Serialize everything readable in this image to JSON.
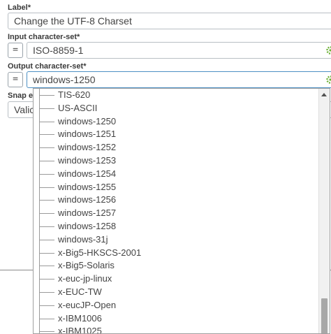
{
  "form": {
    "label": {
      "title": "Label*",
      "value": "Change the UTF-8 Charset"
    },
    "input_charset": {
      "title": "Input character-set*",
      "value": "ISO-8859-1",
      "eq_label": "="
    },
    "output_charset": {
      "title": "Output character-set*",
      "value": "windows-1250",
      "eq_label": "="
    },
    "snap": {
      "title": "Snap e",
      "value": "Valic"
    }
  },
  "dropdown": {
    "options": [
      "TIS-620",
      "US-ASCII",
      "windows-1250",
      "windows-1251",
      "windows-1252",
      "windows-1253",
      "windows-1254",
      "windows-1255",
      "windows-1256",
      "windows-1257",
      "windows-1258",
      "windows-31j",
      "x-Big5-HKSCS-2001",
      "x-Big5-Solaris",
      "x-euc-jp-linux",
      "x-EUC-TW",
      "x-eucJP-Open",
      "x-IBM1006",
      "x-IBM1025"
    ]
  },
  "colors": {
    "accent_gear": "#6fb33a",
    "field_border": "#b9bfc4",
    "active_border": "#4d90c4"
  },
  "icons": {
    "gear": "gear-icon",
    "scroll_up": "scroll-up-arrow-icon"
  }
}
